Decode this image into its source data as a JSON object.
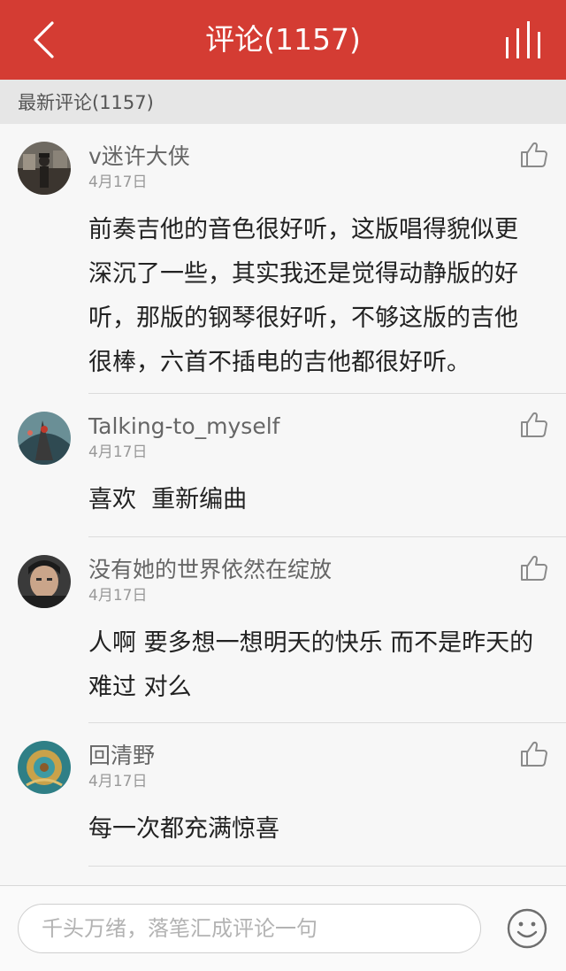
{
  "header": {
    "title": "评论(1157)",
    "background": "#d43c33"
  },
  "section": {
    "label": "最新评论(1157)"
  },
  "comments": [
    {
      "user": "v迷许大侠",
      "date": "4月17日",
      "text": "前奏吉他的音色很好听，这版唱得貌似更深沉了一些，其实我还是觉得动静版的好听，那版的钢琴很好听，不够这版的吉他很棒，六首不插电的吉他都很好听。"
    },
    {
      "user": "Talking-to_myself",
      "date": "4月17日",
      "text": "喜欢  重新编曲"
    },
    {
      "user": "没有她的世界依然在绽放",
      "date": "4月17日",
      "text": "人啊 要多想一想明天的快乐 而不是昨天的难过 对么"
    },
    {
      "user": "回清野",
      "date": "4月17日",
      "text": "每一次都充满惊喜"
    }
  ],
  "footer": {
    "placeholder": "千头万绪，落笔汇成评论一句"
  },
  "icons": {
    "back": "back-chevron-icon",
    "chart": "bar-chart-icon",
    "like": "thumbs-up-icon",
    "emoji": "smiley-icon"
  }
}
